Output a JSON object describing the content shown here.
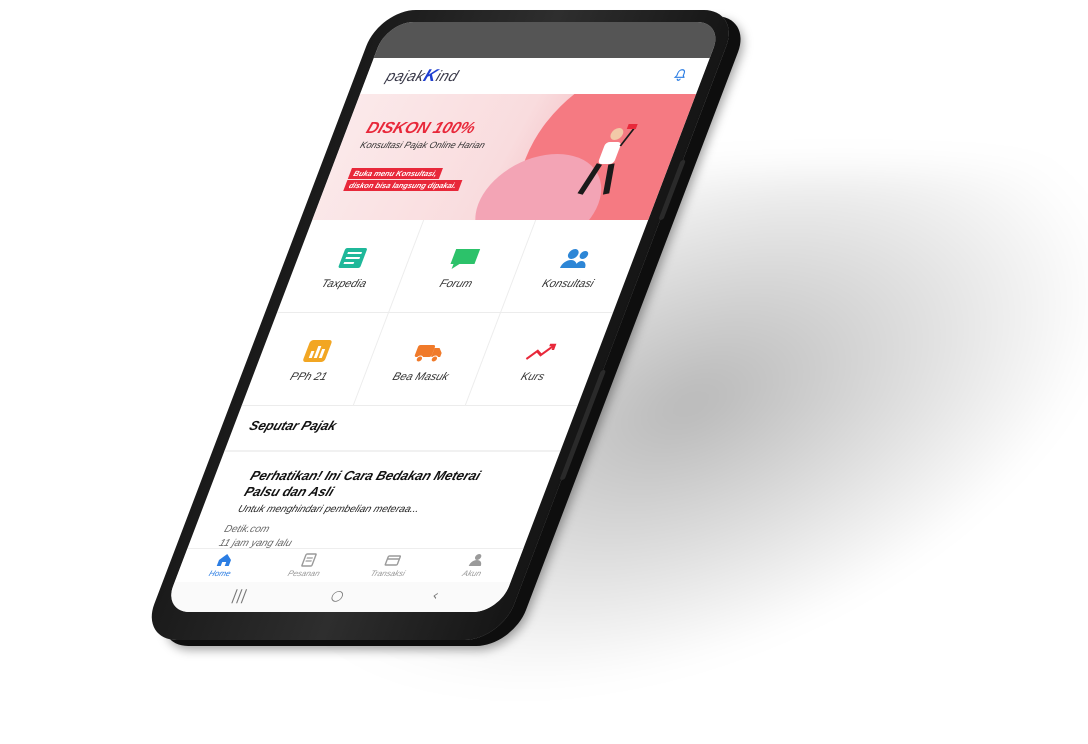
{
  "app": {
    "logo_prefix": "pajak",
    "logo_mark": "K",
    "logo_suffix": "ind",
    "bell_icon": "bell-icon"
  },
  "banner": {
    "title": "DISKON 100%",
    "subtitle": "Konsultasi Pajak Online Harian",
    "tag_line1": "Buka menu Konsultasi,",
    "tag_line2": "diskon bisa langsung dipakai."
  },
  "menu": [
    {
      "label": "Taxpedia",
      "icon": "book-icon",
      "color": "#1fb89a"
    },
    {
      "label": "Forum",
      "icon": "chat-icon",
      "color": "#2cc26a"
    },
    {
      "label": "Konsultasi",
      "icon": "users-icon",
      "color": "#2d86d6"
    },
    {
      "label": "PPh 21",
      "icon": "bar-chart-icon",
      "color": "#f2a623"
    },
    {
      "label": "Bea Masuk",
      "icon": "truck-icon",
      "color": "#f07a2a"
    },
    {
      "label": "Kurs",
      "icon": "trend-icon",
      "color": "#e8283a"
    }
  ],
  "section": {
    "title": "Seputar Pajak"
  },
  "news": {
    "title": "Perhatikan! Ini Cara Bedakan Meterai Palsu dan Asli",
    "description": "Untuk menghindari pembelian meteraa...",
    "source": "Detik.com",
    "time": "11 jam yang lalu"
  },
  "bottom_nav": [
    {
      "label": "Home",
      "icon": "home-icon",
      "active": true
    },
    {
      "label": "Pesanan",
      "icon": "list-icon",
      "active": false
    },
    {
      "label": "Transaksi",
      "icon": "card-icon",
      "active": false
    },
    {
      "label": "Akun",
      "icon": "user-icon",
      "active": false
    }
  ],
  "system_nav": {
    "recents": "|||",
    "home": "○",
    "back": "‹"
  },
  "colors": {
    "accent": "#e8283a",
    "nav_active": "#2b7de3",
    "logo_blue": "#1f3fd1"
  }
}
